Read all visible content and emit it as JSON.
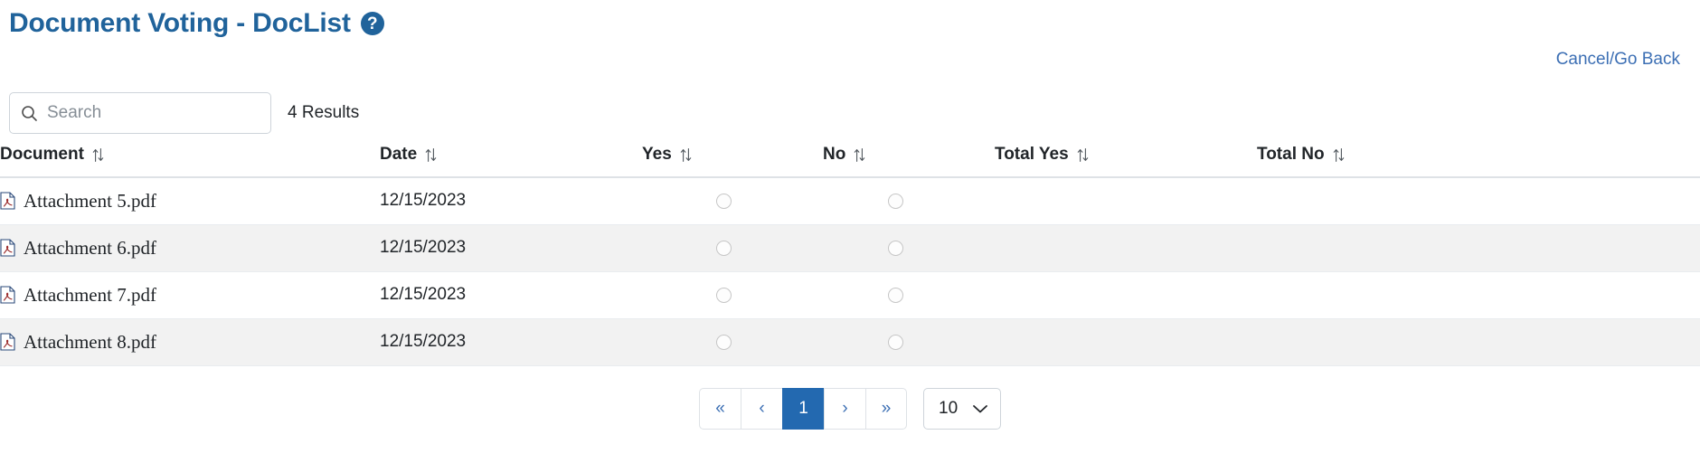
{
  "header": {
    "title": "Document Voting - DocList",
    "help_icon": "question-mark-circle-icon",
    "cancel_link": "Cancel/Go Back"
  },
  "search": {
    "placeholder": "Search",
    "value": "",
    "icon": "search-icon",
    "results_text": "4 Results"
  },
  "table": {
    "columns": [
      {
        "label": "Document",
        "sort_icon": "sort-updown-icon"
      },
      {
        "label": "Date",
        "sort_icon": "sort-updown-icon"
      },
      {
        "label": "Yes",
        "sort_icon": "sort-updown-icon"
      },
      {
        "label": "No",
        "sort_icon": "sort-updown-icon"
      },
      {
        "label": "Total Yes",
        "sort_icon": "sort-updown-icon"
      },
      {
        "label": "Total No",
        "sort_icon": "sort-updown-icon"
      }
    ],
    "rows": [
      {
        "document": "Attachment 5.pdf",
        "file_icon": "pdf-file-icon",
        "date": "12/15/2023",
        "yes_selected": false,
        "no_selected": false,
        "total_yes": "",
        "total_no": ""
      },
      {
        "document": "Attachment 6.pdf",
        "file_icon": "pdf-file-icon",
        "date": "12/15/2023",
        "yes_selected": false,
        "no_selected": false,
        "total_yes": "",
        "total_no": ""
      },
      {
        "document": "Attachment 7.pdf",
        "file_icon": "pdf-file-icon",
        "date": "12/15/2023",
        "yes_selected": false,
        "no_selected": false,
        "total_yes": "",
        "total_no": ""
      },
      {
        "document": "Attachment 8.pdf",
        "file_icon": "pdf-file-icon",
        "date": "12/15/2023",
        "yes_selected": false,
        "no_selected": false,
        "total_yes": "",
        "total_no": ""
      }
    ]
  },
  "pagination": {
    "first_label": "«",
    "prev_label": "‹",
    "next_label": "›",
    "last_label": "»",
    "pages": [
      "1"
    ],
    "current_page": "1",
    "page_size": "10",
    "page_size_chevron": "chevron-down-icon"
  },
  "colors": {
    "brand_blue": "#20639B",
    "link_blue": "#3C6FB4",
    "active_page_blue": "#2369B0",
    "row_stripe": "#f2f2f2",
    "border_gray": "#dee2e6"
  }
}
